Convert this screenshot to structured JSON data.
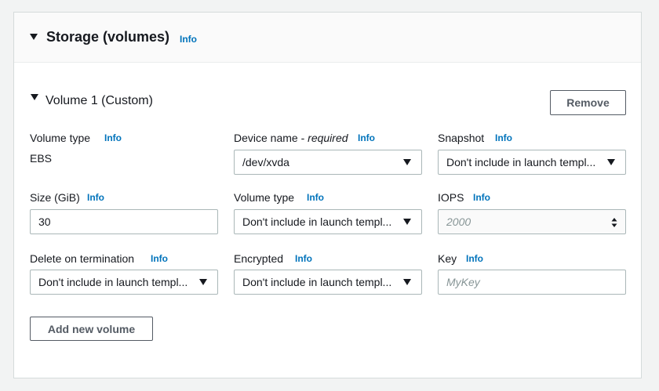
{
  "section": {
    "title": "Storage (volumes)",
    "info": "Info"
  },
  "volume": {
    "title": "Volume 1 (Custom)",
    "remove_label": "Remove",
    "volume_type_label": "Volume type",
    "volume_type_value": "EBS",
    "device_label_main": "Device name - ",
    "device_label_req": "required",
    "device_value": "/dev/xvda",
    "snapshot_label": "Snapshot",
    "snapshot_value": "Don't include in launch templ...",
    "size_label": "Size (GiB)",
    "size_value": "30",
    "ebs_type_label": "Volume type",
    "ebs_type_value": "Don't include in launch templ...",
    "iops_label": "IOPS",
    "iops_placeholder": "2000",
    "delete_label": "Delete on termination",
    "delete_value": "Don't include in launch templ...",
    "encrypted_label": "Encrypted",
    "encrypted_value": "Don't include in launch templ...",
    "key_label": "Key",
    "key_placeholder": "MyKey"
  },
  "info_label": "Info",
  "add_volume_label": "Add new volume"
}
